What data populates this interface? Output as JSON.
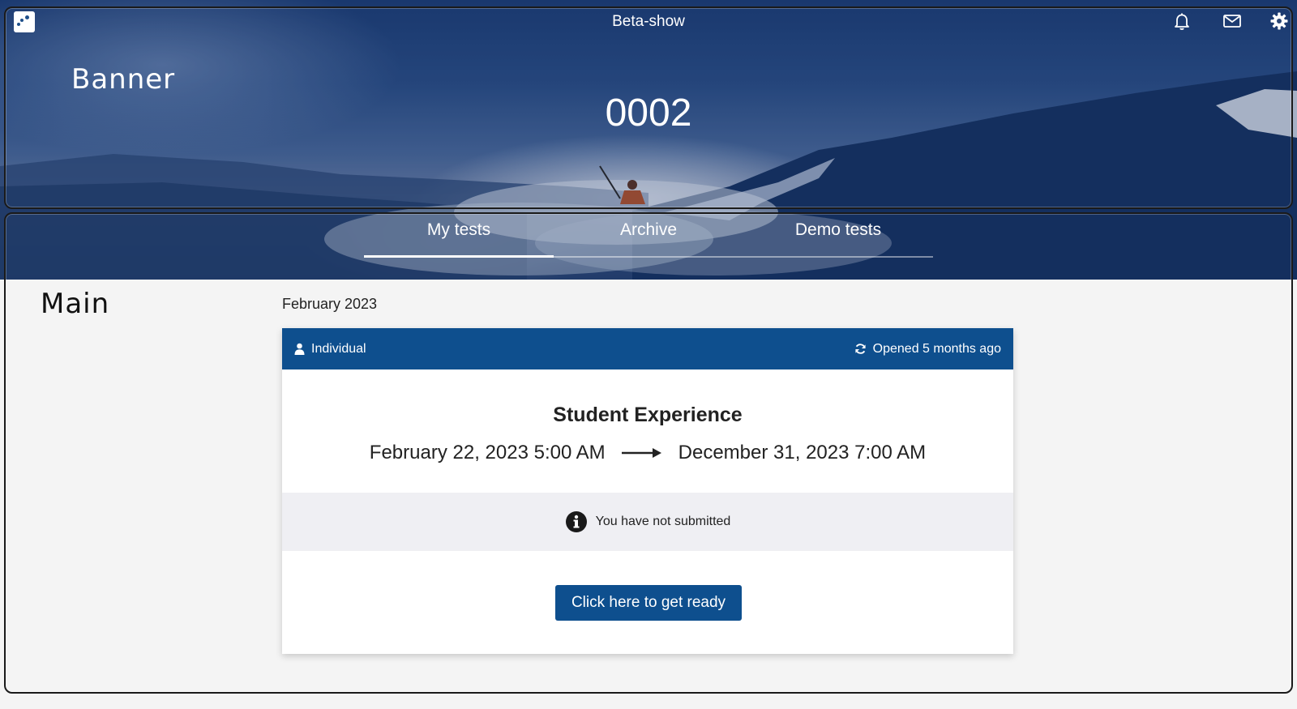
{
  "header": {
    "app_title": "Beta-show",
    "banner_label": "Banner",
    "course_number": "0002",
    "icons": [
      "notification-bell-icon",
      "mail-icon",
      "settings-gear-icon"
    ]
  },
  "tabs": [
    {
      "label": "My tests",
      "active": true
    },
    {
      "label": "Archive",
      "active": false
    },
    {
      "label": "Demo tests",
      "active": false
    }
  ],
  "main": {
    "section_label": "Main",
    "month": "February 2023",
    "test_card": {
      "type_label": "Individual",
      "status_label": "Opened 5 months ago",
      "title": "Student Experience",
      "start": "February 22, 2023 5:00 AM",
      "end": "December 31, 2023 7:00 AM",
      "submission_status": "You have not submitted",
      "action_label": "Click here to get ready"
    }
  },
  "colors": {
    "brand": "#0e4f8e",
    "status_bg": "#efeff3",
    "page_bg": "#f4f4f4"
  }
}
